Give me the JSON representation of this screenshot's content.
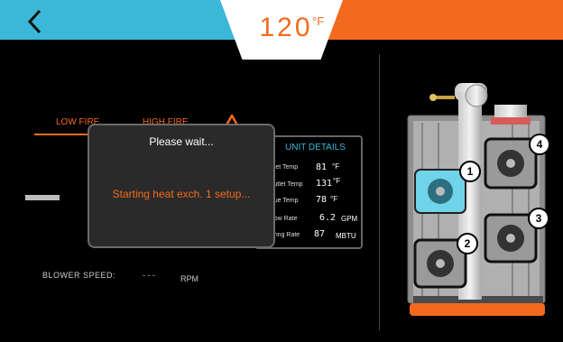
{
  "header": {
    "temperature": "120",
    "unit": "°F"
  },
  "tabs": [
    {
      "label": "LOW FIRE"
    },
    {
      "label": "HIGH FIRE"
    }
  ],
  "unit_details": {
    "title": "UNIT DETAILS",
    "rows": [
      {
        "label": "Inlet Temp:",
        "value": "81",
        "unit": "°F"
      },
      {
        "label": "Outlet Temp:",
        "value": "131",
        "unit": "°F"
      },
      {
        "label": "Flue Temp:",
        "value": "78",
        "unit": "°F"
      },
      {
        "label": "Flow Rate:",
        "value": "6.2",
        "unit": "GPM"
      },
      {
        "label": "Firing Rate:",
        "value": "87",
        "unit": "MBTU"
      }
    ]
  },
  "dialog": {
    "title": "Please wait...",
    "message": "Starting heat exch. 1 setup..."
  },
  "blower": {
    "label": "BLOWER SPEED:",
    "value": "- - -",
    "unit": "RPM"
  },
  "heat_exchangers": [
    {
      "number": "1"
    },
    {
      "number": "2"
    },
    {
      "number": "3"
    },
    {
      "number": "4"
    }
  ],
  "colors": {
    "accent_orange": "#f36a1e",
    "accent_cyan": "#3bb7d8"
  }
}
